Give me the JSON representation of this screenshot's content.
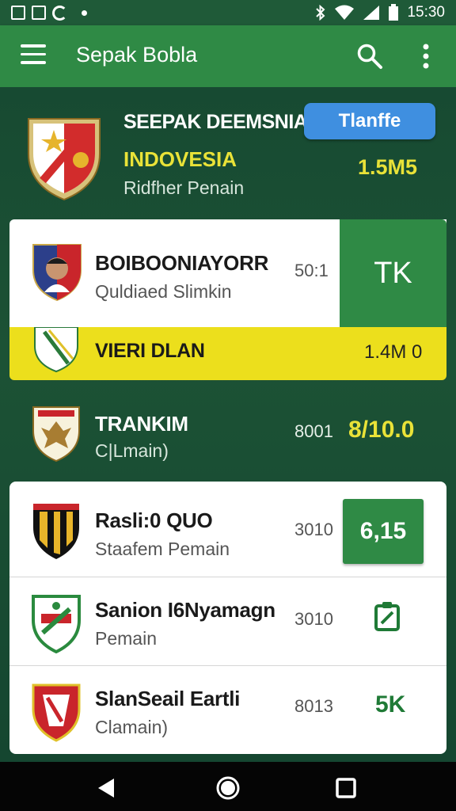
{
  "status_bar": {
    "time": "15:30"
  },
  "app_bar": {
    "title": "Sepak Bobla",
    "icons": [
      "menu-icon",
      "search-icon",
      "more-vert-icon"
    ]
  },
  "header": {
    "title": "SEEPAK DEEMSNIA",
    "country": "INDOVESIA",
    "subtitle": "Ridfher Penain",
    "button_label": "Tlanffe",
    "value": "1.5M5"
  },
  "rows": [
    {
      "name": "BOIBOONIAYORR",
      "sub": "Quldiaed Slimkin",
      "num": "50:1",
      "side_label": "TK"
    },
    {
      "name": "VIERI DLAN",
      "value": "1.4M 0"
    },
    {
      "name": "TRANKIM",
      "sub": "C|Lmain)",
      "num": "8001",
      "value": "8/10.0"
    }
  ],
  "list": [
    {
      "name": "Rasli:0 QUO",
      "sub": "Staafem Pemain",
      "num": "3010",
      "action": "6,15"
    },
    {
      "name": "Sanion I6Nyamagn",
      "sub": "Pemain",
      "num": "3010",
      "action_icon": "edit-icon"
    },
    {
      "name": "SlanSeail Eartli",
      "sub": "Clamain)",
      "num": "8013",
      "action": "5K"
    }
  ],
  "colors": {
    "app_bar": "#2f8a45",
    "background": "#1d4a33",
    "accent_yellow": "#ecdf1c",
    "button_blue": "#3f8fe0"
  }
}
